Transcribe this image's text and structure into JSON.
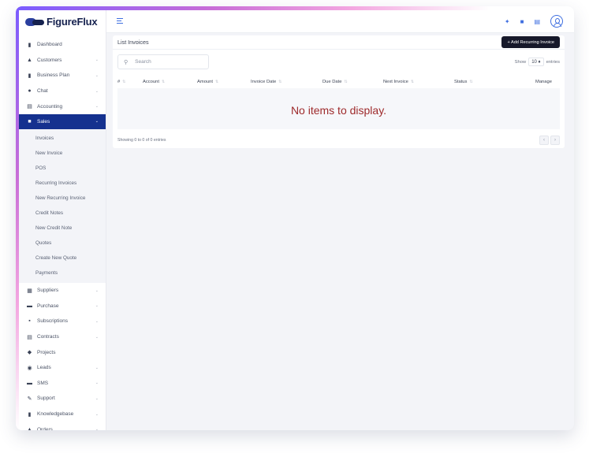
{
  "brand": {
    "name": "FigureFlux"
  },
  "nav": {
    "top_items": [
      {
        "label": "Dashboard",
        "icon": "bar-chart-icon",
        "glyph": "▮",
        "chevron": false
      },
      {
        "label": "Customers",
        "icon": "user-icon",
        "glyph": "▲",
        "chevron": true
      },
      {
        "label": "Business Plan",
        "icon": "business-plan-icon",
        "glyph": "▮",
        "chevron": true
      },
      {
        "label": "Chat",
        "icon": "chat-icon",
        "glyph": "●",
        "chevron": true
      },
      {
        "label": "Accounting",
        "icon": "calculator-icon",
        "glyph": "▤",
        "chevron": true
      }
    ],
    "active_item": {
      "label": "Sales",
      "icon": "sales-icon",
      "glyph": "■"
    },
    "sub_items": [
      "Invoices",
      "New Invoice",
      "POS",
      "Recurring Invoices",
      "New Recurring Invoice",
      "Credit Notes",
      "New Credit Note",
      "Quotes",
      "Create New Quote",
      "Payments"
    ],
    "bottom_items": [
      {
        "label": "Suppliers",
        "icon": "suppliers-icon",
        "glyph": "▦",
        "chevron": true
      },
      {
        "label": "Purchase",
        "icon": "purchase-icon",
        "glyph": "▬",
        "chevron": true
      },
      {
        "label": "Subscriptions",
        "icon": "subscriptions-icon",
        "glyph": "▪",
        "chevron": true
      },
      {
        "label": "Contracts",
        "icon": "contracts-icon",
        "glyph": "▤",
        "chevron": true
      },
      {
        "label": "Projects",
        "icon": "projects-icon",
        "glyph": "◆",
        "chevron": false
      },
      {
        "label": "Leads",
        "icon": "leads-icon",
        "glyph": "◉",
        "chevron": true
      },
      {
        "label": "SMS",
        "icon": "sms-icon",
        "glyph": "▬",
        "chevron": true
      },
      {
        "label": "Support",
        "icon": "support-icon",
        "glyph": "✎",
        "chevron": true
      },
      {
        "label": "Knowledgebase",
        "icon": "knowledgebase-icon",
        "glyph": "▮",
        "chevron": true
      },
      {
        "label": "Orders",
        "icon": "orders-icon",
        "glyph": "▲",
        "chevron": true
      }
    ]
  },
  "header": {
    "icons": [
      "sparkle-icon",
      "folder-icon",
      "document-icon",
      "user-avatar-icon"
    ]
  },
  "card": {
    "title": "List Invoices",
    "add_button": "+ Add Recurring Invoice",
    "search_placeholder": "Search",
    "show_label": "Show",
    "entries_value": "10 ♦",
    "entries_label": "entries",
    "columns": [
      "#",
      "Account",
      "Amount",
      "Invoice Date",
      "Due Date",
      "Next Invoice",
      "Status",
      "Manage"
    ],
    "empty_message": "No items to display.",
    "showing_text": "Showing 0 to 0 of 0 entries",
    "pager": {
      "prev": "‹",
      "next": "›"
    }
  },
  "colors": {
    "accent": "#15318f",
    "button_dark": "#16182a",
    "empty_message": "#9e2a2b",
    "header_icon": "#3f6fe0"
  }
}
